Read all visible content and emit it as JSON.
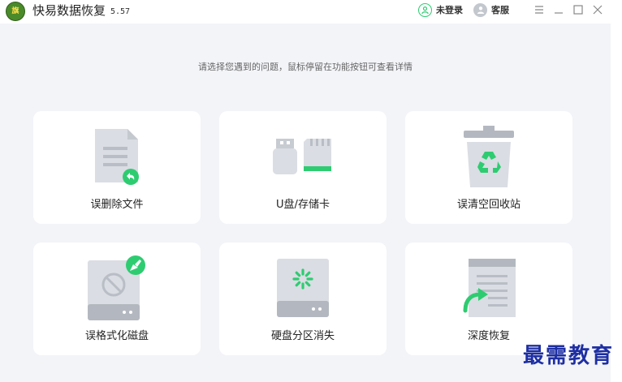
{
  "app": {
    "title": "快易数据恢复",
    "version": "5.57",
    "logo_text": "旗",
    "icon": "app-logo-icon"
  },
  "toolbar": {
    "login_label": "未登录",
    "login_icon": "user-icon",
    "service_label": "客服",
    "service_icon": "customer-service-icon",
    "menu_icon": "menu-icon",
    "minimize_icon": "minimize-icon",
    "maximize_icon": "maximize-icon",
    "close_icon": "close-icon"
  },
  "main": {
    "subtitle": "请选择您遇到的问题，鼠标停留在功能按钮可查看详情",
    "cards": [
      {
        "label": "误删除文件",
        "icon": "deleted-file-icon"
      },
      {
        "label": "U盘/存储卡",
        "icon": "usb-sdcard-icon"
      },
      {
        "label": "误清空回收站",
        "icon": "recycle-bin-icon"
      },
      {
        "label": "误格式化磁盘",
        "icon": "formatted-disk-icon"
      },
      {
        "label": "硬盘分区消失",
        "icon": "hard-drive-partition-icon"
      },
      {
        "label": "深度恢复",
        "icon": "deep-recovery-icon"
      }
    ]
  },
  "watermark": "最需教育",
  "colors": {
    "accent": "#2ecc71",
    "icon_gray": "#d6d9df",
    "icon_dark": "#b3b8c0",
    "background": "#f3f4f8",
    "watermark": "#1e2fa3"
  }
}
